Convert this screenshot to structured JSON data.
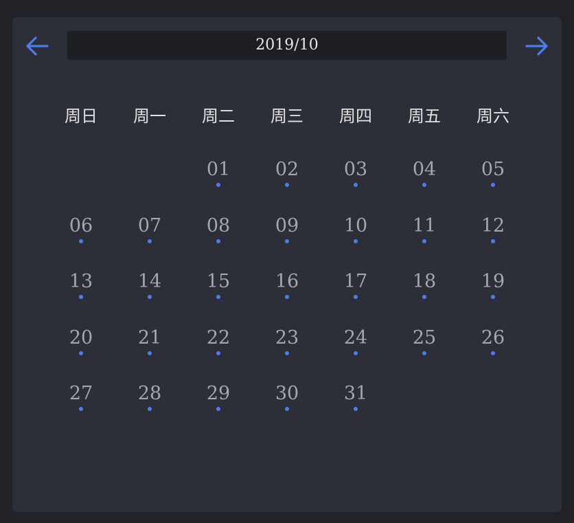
{
  "calendar": {
    "month_label": "2019/10",
    "accent_color": "#4c7cf2",
    "prev_icon": "arrow-left-icon",
    "next_icon": "arrow-right-icon",
    "weekdays": [
      "周日",
      "周一",
      "周二",
      "周三",
      "周四",
      "周五",
      "周六"
    ],
    "leading_blank_days": 2,
    "days": [
      "01",
      "02",
      "03",
      "04",
      "05",
      "06",
      "07",
      "08",
      "09",
      "10",
      "11",
      "12",
      "13",
      "14",
      "15",
      "16",
      "17",
      "18",
      "19",
      "20",
      "21",
      "22",
      "23",
      "24",
      "25",
      "26",
      "27",
      "28",
      "29",
      "30",
      "31"
    ]
  }
}
